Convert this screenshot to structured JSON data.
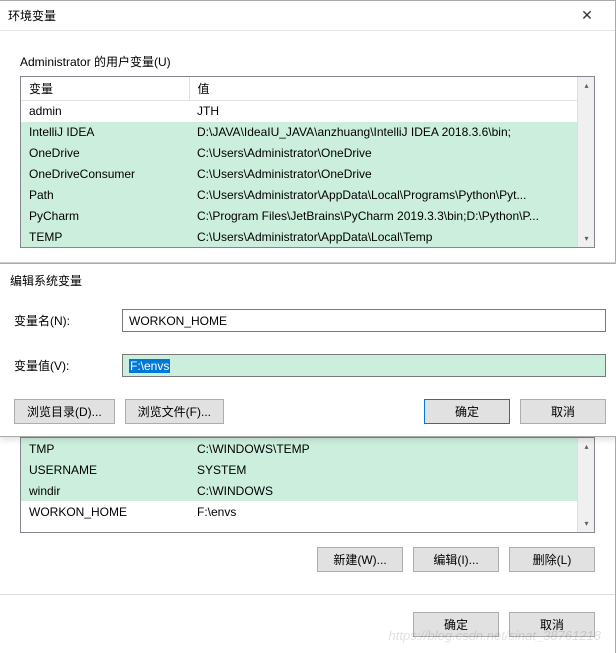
{
  "main_dialog": {
    "title": "环境变量",
    "close_aria": "关闭"
  },
  "user_vars": {
    "section_label": "Administrator 的用户变量(U)",
    "col_var": "变量",
    "col_val": "值",
    "rows": [
      {
        "name": "admin",
        "value": "JTH",
        "hl": false
      },
      {
        "name": "IntelliJ IDEA",
        "value": "D:\\JAVA\\IdeaIU_JAVA\\anzhuang\\IntelliJ IDEA 2018.3.6\\bin;",
        "hl": true
      },
      {
        "name": "OneDrive",
        "value": "C:\\Users\\Administrator\\OneDrive",
        "hl": true
      },
      {
        "name": "OneDriveConsumer",
        "value": "C:\\Users\\Administrator\\OneDrive",
        "hl": true
      },
      {
        "name": "Path",
        "value": "C:\\Users\\Administrator\\AppData\\Local\\Programs\\Python\\Pyt...",
        "hl": true
      },
      {
        "name": "PyCharm",
        "value": "C:\\Program Files\\JetBrains\\PyCharm 2019.3.3\\bin;D:\\Python\\P...",
        "hl": true
      },
      {
        "name": "TEMP",
        "value": "C:\\Users\\Administrator\\AppData\\Local\\Temp",
        "hl": true
      }
    ]
  },
  "edit_dialog": {
    "title": "编辑系统变量",
    "name_label": "变量名(N):",
    "name_value": "WORKON_HOME",
    "value_label": "变量值(V):",
    "value_value": "F:\\envs",
    "browse_dir": "浏览目录(D)...",
    "browse_file": "浏览文件(F)...",
    "ok": "确定",
    "cancel": "取消"
  },
  "sys_vars": {
    "rows": [
      {
        "name": "TMP",
        "value": "C:\\WINDOWS\\TEMP",
        "hl": true
      },
      {
        "name": "USERNAME",
        "value": "SYSTEM",
        "hl": true
      },
      {
        "name": "windir",
        "value": "C:\\WINDOWS",
        "hl": true
      },
      {
        "name": "WORKON_HOME",
        "value": "F:\\envs",
        "hl": false
      }
    ],
    "btn_new": "新建(W)...",
    "btn_edit": "编辑(I)...",
    "btn_delete": "删除(L)"
  },
  "dlg_buttons": {
    "ok": "确定",
    "cancel": "取消"
  },
  "watermark": "https://blog.csdn.net/sinat_38761218"
}
